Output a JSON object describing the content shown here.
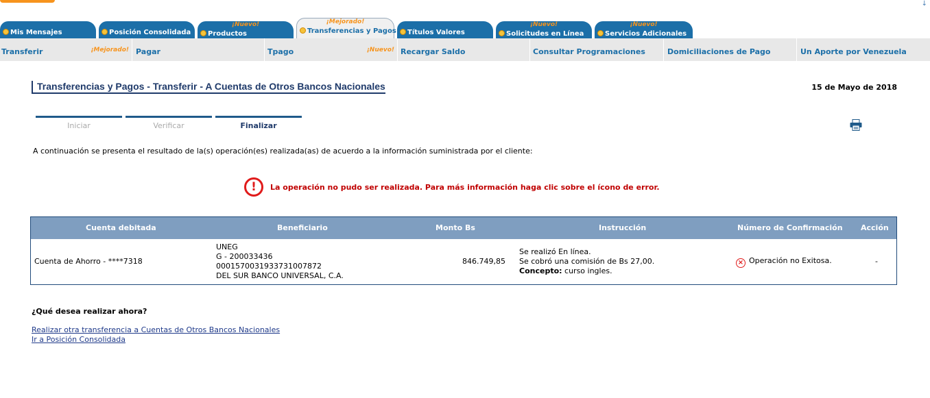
{
  "top": {
    "corner_mark": "↓"
  },
  "tabs": [
    {
      "label": "Mis Mensajes",
      "flag": ""
    },
    {
      "label": "Posición Consolidada",
      "flag": ""
    },
    {
      "label": "Productos",
      "flag": "¡Nuevo!"
    },
    {
      "label": "Transferencias y Pagos",
      "flag": "¡Mejorado!"
    },
    {
      "label": "Títulos Valores",
      "flag": ""
    },
    {
      "label": "Solicitudes en Línea",
      "flag": "¡Nuevo!"
    },
    {
      "label": "Servicios Adicionales",
      "flag": "¡Nuevo!"
    }
  ],
  "subnav": [
    {
      "label": "Transferir",
      "flag": "¡Mejorado!"
    },
    {
      "label": "Pagar",
      "flag": ""
    },
    {
      "label": "Tpago",
      "flag": "¡Nuevo!"
    },
    {
      "label": "Recargar Saldo",
      "flag": ""
    },
    {
      "label": "Consultar Programaciones",
      "flag": ""
    },
    {
      "label": "Domiciliaciones de Pago",
      "flag": ""
    },
    {
      "label": "Un Aporte por Venezuela",
      "flag": ""
    }
  ],
  "page": {
    "title": "Transferencias y Pagos - Transferir - A Cuentas de Otros Bancos Nacionales",
    "date": "15 de Mayo de 2018",
    "intro": "A continuación se presenta el resultado de la(s) operación(es) realizada(as) de acuerdo a la información suministrada por el cliente:",
    "error_symbol": "!",
    "error_message": "La operación no pudo ser realizada. Para más información haga clic sobre el ícono de error."
  },
  "steps": [
    "Iniciar",
    "Verificar",
    "Finalizar"
  ],
  "table": {
    "headers": [
      "Cuenta debitada",
      "Beneficiario",
      "Monto Bs",
      "Instrucción",
      "Número de Confirmación",
      "Acción"
    ],
    "row": {
      "account": "Cuenta de Ahorro - ****7318",
      "beneficiary": [
        "UNEG",
        "G - 200033436",
        "00015700319337310078​72",
        "DEL SUR BANCO UNIVERSAL, C.A."
      ],
      "amount": "846.749,85",
      "instruction_line1": "Se realizó En línea.",
      "instruction_line2": "Se cobró una comisión de Bs 27,00.",
      "concept_label": "Concepto:",
      "concept_value": " curso ingles.",
      "fail_symbol": "×",
      "confirmation": "Operación no Exitosa.",
      "action": "-"
    }
  },
  "next": {
    "question": "¿Qué desea realizar ahora?",
    "link1": "Realizar otra transferencia a Cuentas de Otros Bancos Nacionales",
    "link2": "Ir a Posición Consolidada"
  },
  "colors": {
    "tab_blue": "#1c6fa8",
    "header_blue": "#7f9ec0",
    "error_red": "#e01b1b",
    "accent_orange": "#f7941d"
  }
}
